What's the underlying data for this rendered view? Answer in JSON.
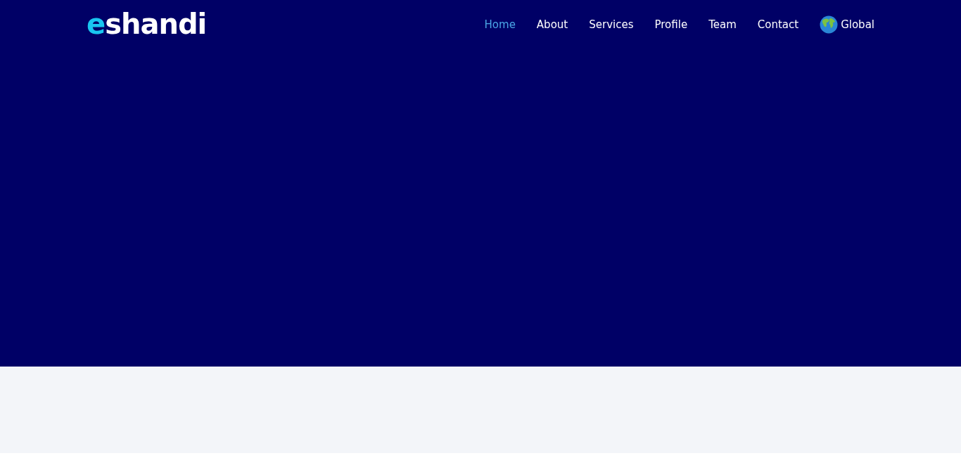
{
  "logo": {
    "mark": "e",
    "text": "shandi"
  },
  "nav": [
    {
      "label": "Home",
      "selected": true
    },
    {
      "label": "About",
      "selected": false
    },
    {
      "label": "Services",
      "selected": false
    },
    {
      "label": "Profile",
      "selected": false
    },
    {
      "label": "Team",
      "selected": false
    },
    {
      "label": "Contact",
      "selected": false
    }
  ],
  "language": {
    "label": "Global"
  }
}
